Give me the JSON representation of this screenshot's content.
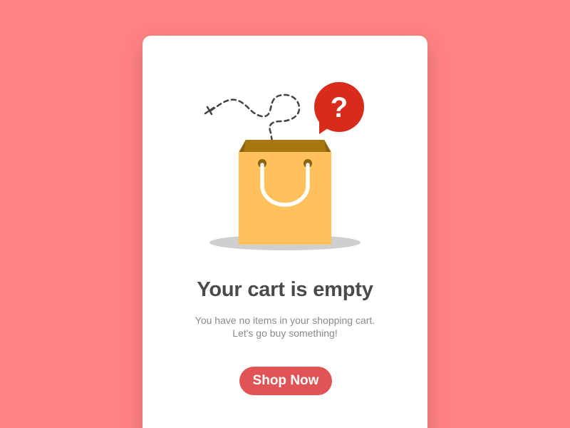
{
  "empty_cart": {
    "title": "Your cart is empty",
    "message_line1": "You have no items in your shopping cart.",
    "message_line2": "Let's go buy something!",
    "cta_label": "Shop Now"
  },
  "illustration": {
    "icons": [
      "shopping-bag-icon",
      "question-bubble-icon",
      "dashed-flight-path-icon",
      "bag-shadow"
    ],
    "question_mark": "?"
  },
  "colors": {
    "background": "#ff8383",
    "card": "#ffffff",
    "bag": "#ffc15b",
    "bag_inner": "#a8770f",
    "bubble": "#d92b1c",
    "button": "#e05456",
    "title": "#4a4a4a",
    "subtitle": "#8a8a8a"
  }
}
